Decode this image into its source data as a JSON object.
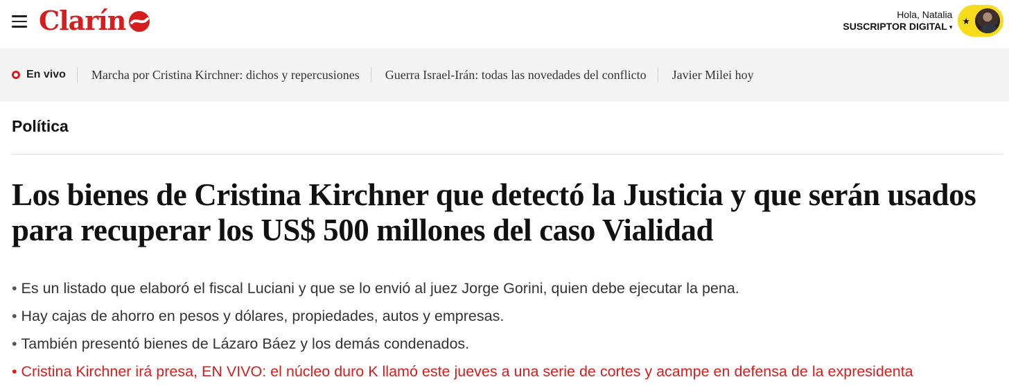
{
  "header": {
    "logo_text": "Clarín",
    "greeting": "Hola, Natalia",
    "subscription_label": "SUSCRIPTOR DIGITAL",
    "subscription_caret": "▾",
    "badge_icon": "★",
    "brand_color": "#d61e1e",
    "badge_color": "#f7dc1e"
  },
  "trending": {
    "live_label": "En vivo",
    "links": [
      "Marcha por Cristina Kirchner: dichos y repercusiones",
      "Guerra Israel-Irán: todas las novedades del conflicto",
      "Javier Milei hoy"
    ]
  },
  "article": {
    "section": "Política",
    "headline": "Los bienes de Cristina Kirchner que detectó la Justicia y que serán usados para recuperar los US$ 500 millones del caso Vialidad",
    "bullets": [
      "Es un listado que elaboró el fiscal Luciani y que se lo envió al juez Jorge Gorini, quien debe ejecutar la pena.",
      "Hay cajas de ahorro en pesos y dólares, propiedades, autos y empresas.",
      "También presentó bienes de Lázaro Báez y los demás condenados.",
      "Cristina Kirchner irá presa, EN VIVO: el núcleo duro K llamó este jueves a una serie de cortes y acampe en defensa de la expresidenta"
    ],
    "bullet_marker": "•"
  }
}
